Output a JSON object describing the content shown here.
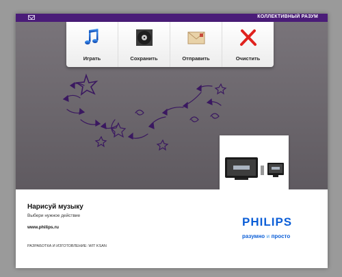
{
  "header": {
    "title": "КОЛЛЕКТИВНЫЙ РАЗУМ",
    "mail_icon": "mail-icon"
  },
  "toolbar": {
    "items": [
      {
        "label": "Играть",
        "icon": "music-note-icon"
      },
      {
        "label": "Сохранить",
        "icon": "vinyl-disc-icon"
      },
      {
        "label": "Отправить",
        "icon": "envelope-icon"
      },
      {
        "label": "Очистить",
        "icon": "red-x-icon"
      }
    ]
  },
  "footer": {
    "title": "Нарисуй музыку",
    "subtitle": "Выбери нужное действие",
    "url": "www.philips.ru",
    "credit": "РАЗРАБОТКА И ИЗГОТОВЛЕНИЕ: WIT KSAN",
    "brand": "PHILIPS",
    "slogan_start": "разумно ",
    "slogan_accent": "и",
    "slogan_end": " просто"
  },
  "colors": {
    "topbar": "#4a1c78",
    "brand_blue": "#0b5ed7",
    "doodle": "#3a1860",
    "clear": "#e0221e"
  }
}
